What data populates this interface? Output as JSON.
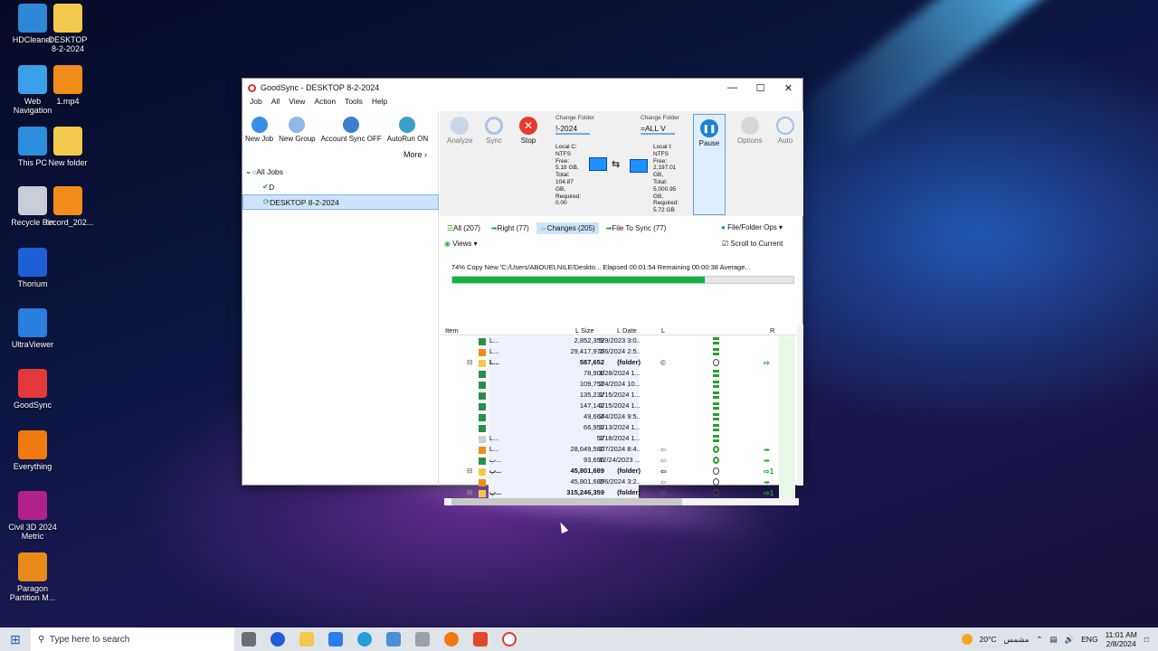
{
  "desktop": {
    "icons": [
      {
        "label": "HDCleaner",
        "icon": "hdcleaner-icon",
        "color": "#2e88d8"
      },
      {
        "label": "DESKTOP\n8-2-2024",
        "icon": "folder-icon",
        "color": "#f2c94c"
      },
      {
        "label": "Web\nNavigation",
        "icon": "globe-icon",
        "color": "#3aa0e8"
      },
      {
        "label": "1.mp4",
        "icon": "vlc-icon",
        "color": "#f28c1a"
      },
      {
        "label": "This PC",
        "icon": "computer-icon",
        "color": "#2d8ee0"
      },
      {
        "label": "New folder",
        "icon": "folder-icon",
        "color": "#f2c94c"
      },
      {
        "label": "Recycle Bin",
        "icon": "recycle-bin-icon",
        "color": "#c9ced6"
      },
      {
        "label": "Record_202...",
        "icon": "vlc-icon",
        "color": "#f28c1a"
      },
      {
        "label": "Thorium",
        "icon": "thorium-icon",
        "color": "#1e5fd6"
      },
      {
        "label": "UltraViewer",
        "icon": "ultraviewer-icon",
        "color": "#2a7fe0"
      },
      {
        "label": "GoodSync",
        "icon": "goodsync-icon",
        "color": "#e23a3a"
      },
      {
        "label": "Everything",
        "icon": "everything-icon",
        "color": "#f07a10"
      },
      {
        "label": "Civil 3D 2024\nMetric",
        "icon": "civil3d-icon",
        "color": "#b0218c"
      },
      {
        "label": "Paragon\nPartition M...",
        "icon": "paragon-icon",
        "color": "#e88a1a"
      }
    ]
  },
  "window": {
    "title": "GoodSync - DESKTOP 8-2-2024",
    "menu": [
      "Job",
      "All",
      "View",
      "Action",
      "Tools",
      "Help"
    ],
    "left_toolbar": [
      {
        "label": "New Job",
        "icon": "plus-circle-icon"
      },
      {
        "label": "New Group",
        "icon": "group-icon"
      },
      {
        "label": "Account Sync OFF",
        "icon": "account-icon"
      },
      {
        "label": "AutoRun ON",
        "icon": "clock-icon"
      }
    ],
    "more_label": "More",
    "tree": [
      {
        "label": "All Jobs",
        "icon": "circle-icon"
      },
      {
        "label": "D",
        "icon": "check-icon"
      },
      {
        "label": "DESKTOP 8-2-2024",
        "icon": "sync-icon",
        "selected": true
      }
    ],
    "right_toolbar": {
      "analyze": "Analyze",
      "sync": "Sync",
      "stop": "Stop",
      "pause": "Pause",
      "options": "Options",
      "auto": "Auto",
      "left_folder": {
        "header": "Change Folder",
        "value": "!-2024",
        "info": "Local C:\nNTFS\nFree:\n5.18 GB,\nTotal:\n104.87\nGB,\nRequired:\n0.00"
      },
      "right_folder": {
        "header": "Change Folder",
        "value": "=ALL V",
        "info": "Local I:\nNTFS\nFree:\n2,197.01\nGB,\nTotal:\n5,000.95\nGB,\nRequired:\n5.72 GB"
      }
    },
    "tabs": [
      {
        "label": "All (207)",
        "icon": "list-icon"
      },
      {
        "label": "Right (77)",
        "icon": "arrow-right-icon"
      },
      {
        "label": "Changes (205)",
        "icon": "changes-icon",
        "active": true
      },
      {
        "label": "File To Sync (77)",
        "icon": "arrow-right-icon"
      }
    ],
    "file_ops": "File/Folder Ops",
    "views": "Views",
    "scroll_to_current": "Scroll to Current",
    "progress": {
      "text": "74% Copy New 'C:/Users/ABOUELNILE/Deskto... Elapsed 00:01:54 Remaining 00:00:38 Average...",
      "fraction": 0.74
    },
    "grid": {
      "headers": {
        "item": "Item",
        "lsize": "L Size",
        "ldate": "L Date",
        "l": "L",
        "r": "R"
      },
      "rows": [
        {
          "name": "L...",
          "size": "2,852,352",
          "date": "5/9/2023 3:0...",
          "icon": "excel",
          "l": "",
          "mid": "eq",
          "r": ""
        },
        {
          "name": "L...",
          "size": "29,417,976",
          "date": "2/6/2024 2:5...",
          "icon": "vlc",
          "l": "",
          "mid": "eq",
          "r": ""
        },
        {
          "name": "L...",
          "size": "587,652",
          "date": "(folder)",
          "icon": "folder",
          "l": "©",
          "mid": "circle",
          "r": "⇨",
          "bold": true
        },
        {
          "name": "",
          "size": "78,906",
          "date": "1/28/2024 1...",
          "icon": "excel",
          "l": "",
          "mid": "eq",
          "r": ""
        },
        {
          "name": "",
          "size": "109,752",
          "date": "2/4/2024 10...",
          "icon": "excel",
          "l": "",
          "mid": "eq",
          "r": ""
        },
        {
          "name": "",
          "size": "135,237",
          "date": "1/15/2024 1...",
          "icon": "excel",
          "l": "",
          "mid": "eq",
          "r": ""
        },
        {
          "name": "",
          "size": "147,142",
          "date": "1/15/2024 1...",
          "icon": "excel",
          "l": "",
          "mid": "eq",
          "r": ""
        },
        {
          "name": "",
          "size": "49,664",
          "date": "2/4/2024 9:5...",
          "icon": "excel",
          "l": "",
          "mid": "eq",
          "r": ""
        },
        {
          "name": "",
          "size": "66,951",
          "date": "1/13/2024 1...",
          "icon": "excel",
          "l": "",
          "mid": "eq",
          "r": ""
        },
        {
          "name": "L...",
          "size": "57",
          "date": "1/18/2024 1...",
          "icon": "file",
          "l": "",
          "mid": "eq",
          "r": ""
        },
        {
          "name": "L...",
          "size": "28,649,580",
          "date": "2/7/2024 8:4...",
          "icon": "vlc",
          "l": "⇦",
          "mid": "sync",
          "r": "➡"
        },
        {
          "name": "ب...",
          "size": "93,696",
          "date": "12/24/2023 ...",
          "icon": "excel",
          "l": "⇦",
          "mid": "sync",
          "r": "➡"
        },
        {
          "name": "ب...",
          "size": "45,801,689",
          "date": "(folder)",
          "icon": "folder",
          "l": "⇦",
          "mid": "circle",
          "r": "⇨1",
          "bold": true
        },
        {
          "name": "",
          "size": "45,801,689",
          "date": "2/6/2024 3:2...",
          "icon": "vlc",
          "l": "⇦",
          "mid": "circle",
          "r": "➡"
        },
        {
          "name": "ب...",
          "size": "315,246,359",
          "date": "(folder)",
          "icon": "folder",
          "l": "⇦",
          "mid": "circle",
          "r": "⇨1",
          "bold": true
        }
      ]
    }
  },
  "taskbar": {
    "search_placeholder": "Type here to search",
    "weather": "20°C",
    "weather_text": "مشمس",
    "lang": "ENG",
    "time": "11:01 AM",
    "date": "2/8/2024"
  }
}
